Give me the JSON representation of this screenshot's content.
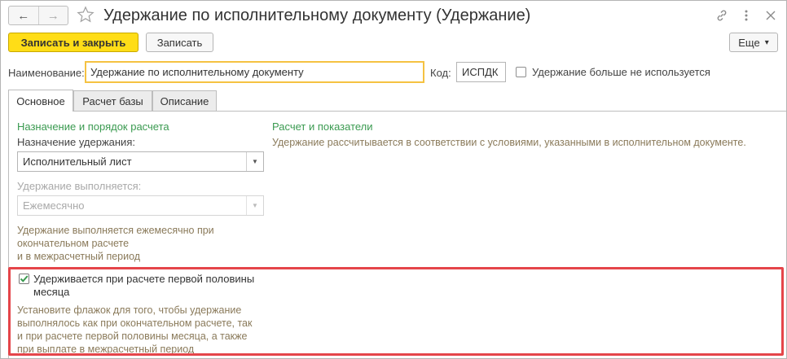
{
  "window": {
    "title": "Удержание по исполнительному документу (Удержание)"
  },
  "nav": {
    "back_icon": "←",
    "forward_icon": "→"
  },
  "title_icons": [
    "link-icon",
    "more-vertical-icon",
    "close-icon"
  ],
  "toolbar": {
    "save_close_label": "Записать и закрыть",
    "save_label": "Записать",
    "more_label": "Еще",
    "more_caret": "▾"
  },
  "form": {
    "name_label": "Наименование:",
    "name_value": "Удержание по исполнительному документу",
    "code_label": "Код:",
    "code_value": "ИСПДК",
    "not_used_label": "Удержание больше не используется"
  },
  "tabs": [
    {
      "label": "Основное",
      "active": true
    },
    {
      "label": "Расчет базы",
      "active": false
    },
    {
      "label": "Описание",
      "active": false
    }
  ],
  "main": {
    "left_group_title": "Назначение и порядок расчета",
    "purpose_label": "Назначение удержания:",
    "purpose_value": "Исполнительный лист",
    "performed_label": "Удержание выполняется:",
    "performed_value": "Ежемесячно",
    "performed_hint": [
      "Удержание выполняется ежемесячно при",
      "окончательном расчете",
      "и в межрасчетный период"
    ],
    "right_group_title": "Расчет и показатели",
    "right_hint": "Удержание рассчитывается в соответствии с условиями, указанными в исполнительном документе.",
    "first_half_label": [
      "Удерживается при расчете первой половины",
      "месяца"
    ],
    "first_half_checked": true,
    "first_half_hint": [
      "Установите флажок для того, чтобы удержание",
      "выполнялось как при окончательном расчете, так",
      "и при расчете первой половины месяца, а также",
      "при выплате в межрасчетный период"
    ]
  },
  "colors": {
    "primary_button": "#ffdd17",
    "group_title": "#3a9a50",
    "hint_text": "#8a7a5a",
    "highlight": "#e5454a",
    "focus_border": "#f5c242"
  }
}
